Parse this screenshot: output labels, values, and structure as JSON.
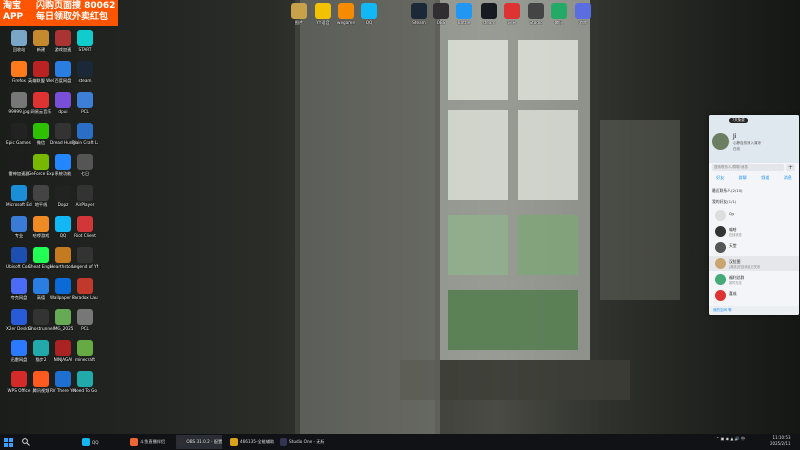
{
  "banner": {
    "line1": "淘宝",
    "line2": "APP",
    "promo1": "闪购页面搜 80062",
    "promo2": "每日领取外卖红包"
  },
  "desktop_icons": [
    {
      "label": "回收站",
      "color": "#7aa6c8"
    },
    {
      "label": "Firefox",
      "color": "#ff7a1a"
    },
    {
      "label": "99999.jpg",
      "color": "#777"
    },
    {
      "label": "Epic Games Launcher",
      "color": "#222"
    },
    {
      "label": "雷神加速器",
      "color": "#1d1d1d"
    },
    {
      "label": "Microsoft Edge",
      "color": "#1a8fd8"
    },
    {
      "label": "专业",
      "color": "#3a7bd5"
    },
    {
      "label": "Ubisoft Connect",
      "color": "#1c4fb0"
    },
    {
      "label": "夸克网盘",
      "color": "#4a6cf7"
    },
    {
      "label": "X2er Desktop",
      "color": "#2a5bd7"
    },
    {
      "label": "迅雷网盘",
      "color": "#2b79ff"
    },
    {
      "label": "WPS Office",
      "color": "#d42a2a"
    },
    {
      "label": "新建",
      "color": "#c68a2e"
    },
    {
      "label": "英雄联盟 WeGame",
      "color": "#b22"
    },
    {
      "label": "网易云音乐",
      "color": "#d33"
    },
    {
      "label": "微信",
      "color": "#2dc100"
    },
    {
      "label": "GeForce Experience",
      "color": "#76b900"
    },
    {
      "label": "地平线",
      "color": "#444"
    },
    {
      "label": "哈啰游戏",
      "color": "#f08a24"
    },
    {
      "label": "Cheat Engine",
      "color": "#2f5"
    },
    {
      "label": "高德",
      "color": "#2a7de1"
    },
    {
      "label": "Ghostrunner",
      "color": "#333"
    },
    {
      "label": "猫步2",
      "color": "#2aa"
    },
    {
      "label": "腾讯视频",
      "color": "#ff5a1f"
    },
    {
      "label": "游戏加速",
      "color": "#a33"
    },
    {
      "label": "百度网盘",
      "color": "#2a7de1"
    },
    {
      "label": "dpui",
      "color": "#7a4fd8"
    },
    {
      "label": "Dread Hunger",
      "color": "#333"
    },
    {
      "label": "系统功能",
      "color": "#2486ff"
    },
    {
      "label": "Dopz",
      "color": "#222"
    },
    {
      "label": "QQ",
      "color": "#12b7f5"
    },
    {
      "label": "Hearthstone",
      "color": "#c47a1e"
    },
    {
      "label": "Wallpaper Engine",
      "color": "#0b6bd6"
    },
    {
      "label": "IMG_2025",
      "color": "#6a5"
    },
    {
      "label": "NINJAGAI",
      "color": "#a22"
    },
    {
      "label": "RV There Yet",
      "color": "#1f6fd1"
    },
    {
      "label": "START",
      "color": "#1cc"
    },
    {
      "label": "steam",
      "color": "#1b2838"
    },
    {
      "label": "PCL",
      "color": "#3d7fd6"
    },
    {
      "label": "Plain Craft Launcher",
      "color": "#2b6ec6"
    },
    {
      "label": "七日",
      "color": "#555"
    },
    {
      "label": "AirPlayer",
      "color": "#333"
    },
    {
      "label": "Riot Client",
      "color": "#d13639"
    },
    {
      "label": "Legend of YMIR",
      "color": "#333"
    },
    {
      "label": "Paradox Launcher",
      "color": "#c0392b"
    },
    {
      "label": "PCL",
      "color": "#777"
    },
    {
      "label": "minecraft",
      "color": "#6a4"
    },
    {
      "label": "Need To Go",
      "color": "#2aa"
    }
  ],
  "taskbar_top_icons": [
    {
      "label": "图片",
      "color": "#c7a24a"
    },
    {
      "label": "YY语音",
      "color": "#f2c200"
    },
    {
      "label": "wegame",
      "color": "#f48b00"
    },
    {
      "label": "QQ",
      "color": "#12b7f5"
    },
    {
      "label": "Steam",
      "color": "#1b2838"
    },
    {
      "label": "OBS",
      "color": "#302e31"
    },
    {
      "label": "Battle",
      "color": "#2196f3"
    },
    {
      "label": "steam",
      "color": "#171a21"
    },
    {
      "label": "网易",
      "color": "#d33"
    },
    {
      "label": "Studio",
      "color": "#444"
    },
    {
      "label": "腾讯",
      "color": "#2a6"
    },
    {
      "label": "游戏",
      "color": "#5b6ee1"
    }
  ],
  "qq": {
    "chip": "7天免费",
    "nickname": "Ji",
    "signature": "心静自然凉入清凉",
    "status": "在线",
    "search_placeholder": "搜索联系人/群聊/消息",
    "plus": "+",
    "tabs": [
      "好友",
      "群聊",
      "频道",
      "消息"
    ],
    "groups": [
      "最近联系人(2/10)",
      "我的好友(1/1)"
    ],
    "contacts": [
      {
        "name": "Qy",
        "status": "",
        "color": "#ddd"
      },
      {
        "name": "喵哈",
        "status": "在线状态",
        "color": "#333"
      },
      {
        "name": "天堂",
        "status": "",
        "color": "#555"
      },
      {
        "name": "汉拉图",
        "status": "[离线]在线消息已关闭",
        "color": "#c9a571"
      },
      {
        "name": "福利总群",
        "status": "暂时无法",
        "color": "#4a7"
      },
      {
        "name": "喜成",
        "status": "",
        "color": "#d33"
      }
    ],
    "bottom": "我的空间 等"
  },
  "taskbar": {
    "apps": [
      {
        "label": "QQ",
        "color": "#12b7f5"
      },
      {
        "label": "斗鱼直播伴侣",
        "color": "#e63"
      },
      {
        "label": "OBS 31.0.2 - 配置文件",
        "color": "#302e31"
      },
      {
        "label": "466135-全能辅助",
        "color": "#d9a21a"
      },
      {
        "label": "Studio One - 无标题",
        "color": "#335"
      }
    ],
    "time": "11:10:53",
    "date": "2025/2/11"
  }
}
